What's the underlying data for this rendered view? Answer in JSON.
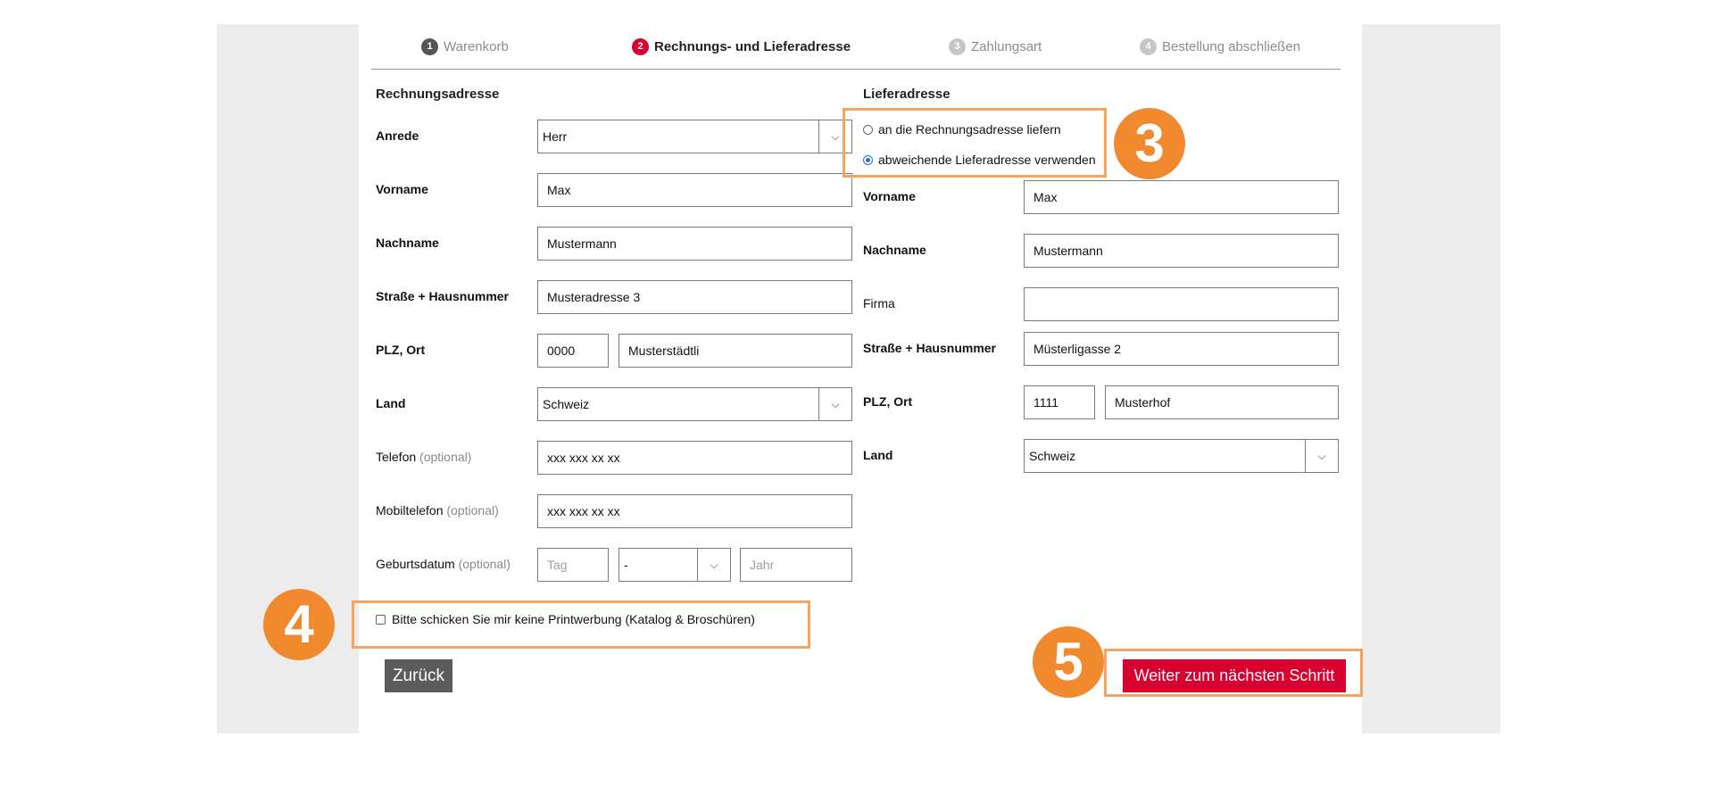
{
  "steps": [
    {
      "num": "1",
      "label": "Warenkorb"
    },
    {
      "num": "2",
      "label": "Rechnungs- und Lieferadresse"
    },
    {
      "num": "3",
      "label": "Zahlungsart"
    },
    {
      "num": "4",
      "label": "Bestellung abschließen"
    }
  ],
  "billing": {
    "title": "Rechnungsadresse",
    "salutation_label": "Anrede",
    "salutation_value": "Herr",
    "firstname_label": "Vorname",
    "firstname_value": "Max",
    "lastname_label": "Nachname",
    "lastname_value": "Mustermann",
    "street_label": "Straße + Hausnummer",
    "street_value": "Musteradresse 3",
    "zipcity_label": "PLZ, Ort",
    "zip_value": "0000",
    "city_value": "Musterstädtli",
    "country_label": "Land",
    "country_value": "Schweiz",
    "phone_label": "Telefon",
    "phone_optional": "(optional)",
    "phone_value": "xxx xxx xx xx",
    "mobile_label": "Mobiltelefon",
    "mobile_optional": "(optional)",
    "mobile_value": "xxx xxx xx xx",
    "birthdate_label": "Geburtsdatum",
    "birthdate_optional": "(optional)",
    "birth_day_placeholder": "Tag",
    "birth_month_value": "-",
    "birth_year_placeholder": "Jahr"
  },
  "shipping": {
    "title": "Lieferadresse",
    "option_same": "an die Rechnungsadresse liefern",
    "option_different": "abweichende Lieferadresse verwenden",
    "firstname_label": "Vorname",
    "firstname_value": "Max",
    "lastname_label": "Nachname",
    "lastname_value": "Mustermann",
    "company_label": "Firma",
    "company_value": "",
    "street_label": "Straße + Hausnummer",
    "street_value": "Müsterligasse 2",
    "zipcity_label": "PLZ, Ort",
    "zip_value": "1111",
    "city_value": "Musterhof",
    "country_label": "Land",
    "country_value": "Schweiz"
  },
  "newsletter": {
    "label": "Bitte schicken Sie mir keine Printwerbung (Katalog & Broschüren)"
  },
  "buttons": {
    "back": "Zurück",
    "next": "Weiter zum nächsten Schritt"
  },
  "annotations": {
    "badge_3": "3",
    "badge_4": "4",
    "badge_5": "5"
  },
  "colors": {
    "accent": "#d8002f",
    "annotation": "#f18a2e",
    "annotation_border": "#f4a460"
  }
}
